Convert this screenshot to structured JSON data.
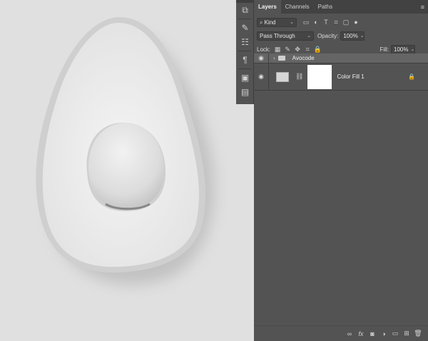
{
  "tabs": [
    {
      "label": "Layers",
      "active": true
    },
    {
      "label": "Channels",
      "active": false
    },
    {
      "label": "Paths",
      "active": false
    }
  ],
  "filter": {
    "label": "Kind",
    "icons": [
      "image-filter-icon",
      "adjustment-filter-icon",
      "type-filter-icon",
      "shape-filter-icon",
      "smart-object-filter-icon",
      "filter-toggle-icon"
    ]
  },
  "blend": {
    "mode": "Pass Through",
    "opacity_label": "Opacity:",
    "opacity_value": "100%"
  },
  "lock": {
    "label": "Lock:",
    "fill_label": "Fill:",
    "fill_value": "100%"
  },
  "layers": [
    {
      "name": "Avocode",
      "type": "group",
      "visible": true,
      "selected": true
    },
    {
      "name": "Color Fill 1",
      "type": "color-fill",
      "visible": true,
      "locked": true
    }
  ],
  "colors": {
    "panel": "#535353",
    "tabbar": "#424242",
    "selected_row": "#656565",
    "canvas": "#e0e0e0"
  }
}
